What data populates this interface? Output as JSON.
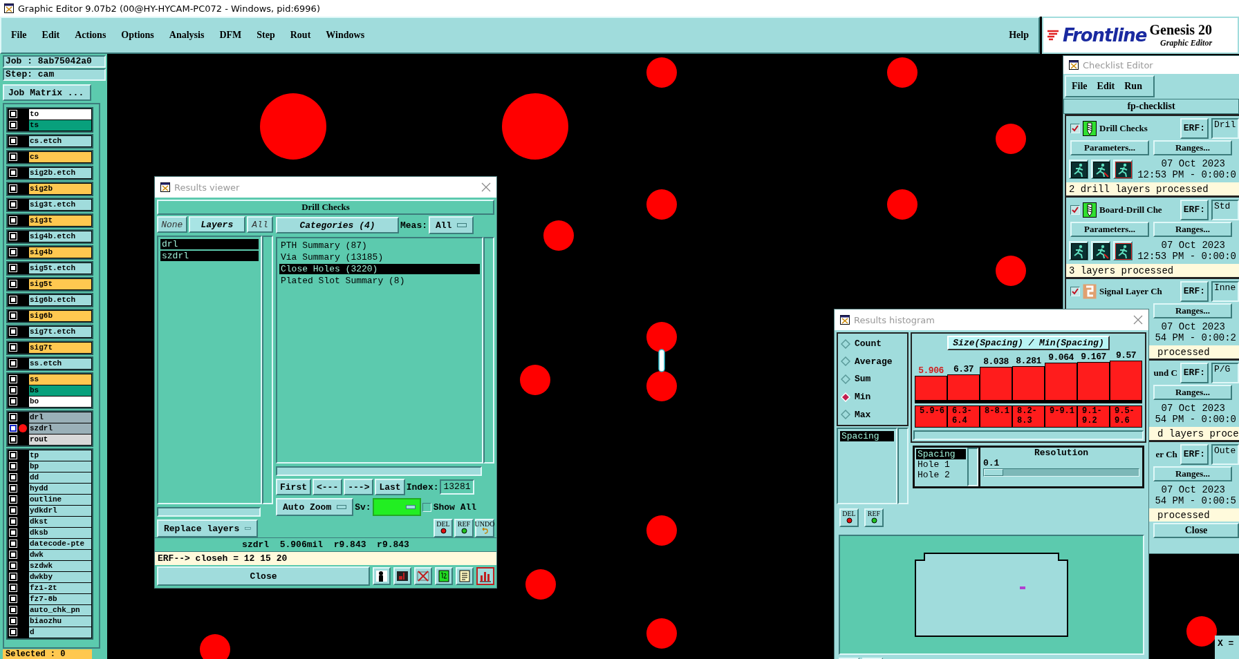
{
  "window": {
    "title": "Graphic Editor 9.07b2 (00@HY-HYCAM-PC072 - Windows, pid:6996)"
  },
  "menu": [
    "File",
    "Edit",
    "Actions",
    "Options",
    "Analysis",
    "DFM",
    "Step",
    "Rout",
    "Windows"
  ],
  "help": "Help",
  "brand": {
    "logo": "Frontline",
    "product": "Genesis 20",
    "subtitle": "Graphic Editor"
  },
  "job": {
    "job": "Job : 8ab75042a0",
    "step": "Step: cam",
    "matrix_button": "Job Matrix ..."
  },
  "layer_groups": [
    {
      "layers": [
        {
          "name": "to",
          "color": "#ffffff",
          "checked": false,
          "work": false
        },
        {
          "name": "ts",
          "color": "#08a07c",
          "checked": false,
          "work": false
        }
      ]
    },
    {
      "layers": [
        {
          "name": "cs.etch",
          "color": "#a0dcdc",
          "checked": false,
          "work": false
        }
      ]
    },
    {
      "layers": [
        {
          "name": "cs",
          "color": "#ffc850",
          "checked": false,
          "work": false
        }
      ]
    },
    {
      "layers": [
        {
          "name": "sig2b.etch",
          "color": "#a0dcdc",
          "checked": false,
          "work": false
        }
      ]
    },
    {
      "layers": [
        {
          "name": "sig2b",
          "color": "#ffc850",
          "checked": false,
          "work": false
        }
      ]
    },
    {
      "layers": [
        {
          "name": "sig3t.etch",
          "color": "#a0dcdc",
          "checked": false,
          "work": false
        }
      ]
    },
    {
      "layers": [
        {
          "name": "sig3t",
          "color": "#ffc850",
          "checked": false,
          "work": false
        }
      ]
    },
    {
      "layers": [
        {
          "name": "sig4b.etch",
          "color": "#a0dcdc",
          "checked": false,
          "work": false
        }
      ]
    },
    {
      "layers": [
        {
          "name": "sig4b",
          "color": "#ffc850",
          "checked": false,
          "work": false
        }
      ]
    },
    {
      "layers": [
        {
          "name": "sig5t.etch",
          "color": "#a0dcdc",
          "checked": false,
          "work": false
        }
      ]
    },
    {
      "layers": [
        {
          "name": "sig5t",
          "color": "#ffc850",
          "checked": false,
          "work": false
        }
      ]
    },
    {
      "layers": [
        {
          "name": "sig6b.etch",
          "color": "#a0dcdc",
          "checked": false,
          "work": false
        }
      ]
    },
    {
      "layers": [
        {
          "name": "sig6b",
          "color": "#ffc850",
          "checked": false,
          "work": false
        }
      ]
    },
    {
      "layers": [
        {
          "name": "sig7t.etch",
          "color": "#a0dcdc",
          "checked": false,
          "work": false
        }
      ]
    },
    {
      "layers": [
        {
          "name": "sig7t",
          "color": "#ffc850",
          "checked": false,
          "work": false
        }
      ]
    },
    {
      "layers": [
        {
          "name": "ss.etch",
          "color": "#a0dcdc",
          "checked": false,
          "work": false
        }
      ]
    },
    {
      "layers": [
        {
          "name": "ss",
          "color": "#ffc850",
          "checked": false,
          "work": false
        },
        {
          "name": "bs",
          "color": "#08a07c",
          "checked": false,
          "work": false
        },
        {
          "name": "bo",
          "color": "#ffffff",
          "checked": false,
          "work": false
        }
      ]
    },
    {
      "layers": [
        {
          "name": "drl",
          "color": "#9ab0b8",
          "checked": false,
          "work": false
        },
        {
          "name": "szdrl",
          "color": "#9ab0b8",
          "checked": false,
          "work": true
        },
        {
          "name": "rout",
          "color": "#d8d8d8",
          "checked": false,
          "work": false
        }
      ]
    },
    {
      "layers": [
        {
          "name": "tp",
          "color": "#a0dcdc",
          "checked": false,
          "work": false
        },
        {
          "name": "bp",
          "color": "#a0dcdc",
          "checked": false,
          "work": false
        },
        {
          "name": "dd",
          "color": "#a0dcdc",
          "checked": false,
          "work": false
        },
        {
          "name": "hydd",
          "color": "#a0dcdc",
          "checked": false,
          "work": false
        },
        {
          "name": "outline",
          "color": "#a0dcdc",
          "checked": false,
          "work": false
        },
        {
          "name": "ydkdrl",
          "color": "#a0dcdc",
          "checked": false,
          "work": false
        },
        {
          "name": "dkst",
          "color": "#a0dcdc",
          "checked": false,
          "work": false
        },
        {
          "name": "dksb",
          "color": "#a0dcdc",
          "checked": false,
          "work": false
        },
        {
          "name": "datecode-pte",
          "color": "#a0dcdc",
          "checked": false,
          "work": false
        },
        {
          "name": "dwk",
          "color": "#a0dcdc",
          "checked": false,
          "work": false
        },
        {
          "name": "szdwk",
          "color": "#a0dcdc",
          "checked": false,
          "work": false
        },
        {
          "name": "dwkby",
          "color": "#a0dcdc",
          "checked": false,
          "work": false
        },
        {
          "name": "fz1-2t",
          "color": "#a0dcdc",
          "checked": false,
          "work": false
        },
        {
          "name": "fz7-8b",
          "color": "#a0dcdc",
          "checked": false,
          "work": false
        },
        {
          "name": "auto_chk_pn",
          "color": "#a0dcdc",
          "checked": false,
          "work": false
        },
        {
          "name": "biaozhu",
          "color": "#a0dcdc",
          "checked": false,
          "work": false
        },
        {
          "name": "d",
          "color": "#a0dcdc",
          "checked": false,
          "work": false
        }
      ]
    }
  ],
  "selected_count": "Selected : 0",
  "results_viewer": {
    "title": "Results viewer",
    "header": "Drill Checks",
    "layer_tabs": [
      {
        "label": "None",
        "selected": false
      },
      {
        "label": "Layers",
        "selected": true
      },
      {
        "label": "All",
        "selected": false
      }
    ],
    "categories_header": "Categories (4)",
    "meas_label": "Meas:",
    "meas_value": "All",
    "layers": [
      {
        "name": "drl",
        "selected": true
      },
      {
        "name": "szdrl",
        "selected": true
      }
    ],
    "categories": [
      {
        "name": "PTH Summary (87)",
        "selected": false
      },
      {
        "name": "Via Summary (13185)",
        "selected": false
      },
      {
        "name": "Close Holes (3220)",
        "selected": true
      },
      {
        "name": "Plated Slot Summary (8)",
        "selected": false
      }
    ],
    "nav_buttons": [
      "First",
      "<---",
      "--->",
      "Last"
    ],
    "index_label": "Index:",
    "index_value": "13281",
    "zoom_mode": "Auto Zoom",
    "sv_label": "Sv:",
    "show_all": {
      "label": "Show All",
      "checked": false
    },
    "replace_mode": "Replace layers",
    "edit_buttons": [
      {
        "label": "DEL",
        "kind": "del"
      },
      {
        "label": "REF",
        "kind": "ref"
      },
      {
        "label": "UNDO",
        "kind": "undo"
      }
    ],
    "status": "szdrl  5.906mil  r9.843  r9.843",
    "erf": "ERF--> closeh = 12 15 20",
    "close": "Close",
    "tool_buttons": [
      {
        "kind": "figure",
        "selected": false
      },
      {
        "kind": "layer",
        "selected": false
      },
      {
        "kind": "cross",
        "selected": false
      },
      {
        "kind": "page",
        "selected": false
      },
      {
        "kind": "notes",
        "selected": false
      },
      {
        "kind": "chart",
        "selected": true
      }
    ]
  },
  "histogram": {
    "title": "Results histogram",
    "modes": [
      {
        "label": "Count",
        "selected": false
      },
      {
        "label": "Average",
        "selected": false
      },
      {
        "label": "Sum",
        "selected": false
      },
      {
        "label": "Min",
        "selected": true
      },
      {
        "label": "Max",
        "selected": false
      }
    ],
    "measures": [
      {
        "name": "Spacing",
        "selected": true
      }
    ],
    "edit_buttons": [
      {
        "label": "DEL",
        "kind": "del"
      },
      {
        "label": "REF",
        "kind": "ref"
      }
    ],
    "chart_data": {
      "type": "bar",
      "title": "Size(Spacing) / Min(Spacing)",
      "categories": [
        "5.9-6",
        "6.3-6.4",
        "8-8.1",
        "8.2-8.3",
        "9-9.1",
        "9.1-9.2",
        "9.5-9.6"
      ],
      "series": [
        {
          "color": "#ff1c1c",
          "values": [
            5.906,
            6.37,
            8.038,
            8.281,
            9.064,
            9.167,
            9.57
          ]
        }
      ],
      "data_labels": true
    },
    "value_labels": [
      "5.906",
      "6.37",
      "8.038",
      "8.281",
      "9.064",
      "9.167",
      "9.57"
    ],
    "fields": [
      {
        "name": "Spacing",
        "selected": true
      },
      {
        "name": "Hole 1",
        "selected": false
      },
      {
        "name": "Hole 2",
        "selected": false
      }
    ],
    "resolution_label": "Resolution",
    "resolution_value": "0.1",
    "resolution": {
      "level": 0.12
    }
  },
  "checklist": {
    "title": "Checklist Editor",
    "menu": [
      "File",
      "Edit",
      "Run"
    ],
    "name": "fp-checklist",
    "entries": [
      {
        "checked": true,
        "kind": "drill",
        "name": "Drill Checks",
        "erf_label": "ERF:",
        "erf": "Dril",
        "parameters": "Parameters...",
        "ranges": "Ranges...",
        "date": "07 Oct 2023",
        "time": "12:53 PM - 0:00:0",
        "status": "2 drill layers processed"
      },
      {
        "checked": true,
        "kind": "drill",
        "name": "Board-Drill Che",
        "erf_label": "ERF:",
        "erf": "Std",
        "parameters": "Parameters...",
        "ranges": "Ranges...",
        "date": "07 Oct 2023",
        "time": "12:53 PM - 0:00:0",
        "status": "3 layers processed"
      },
      {
        "checked": true,
        "kind": "signal",
        "name": "Signal Layer Ch",
        "erf_label": "ERF:",
        "erf": "Inne",
        "ranges": "Ranges...",
        "date": "07 Oct 2023",
        "time": "54 PM - 0:00:2",
        "status": "processed"
      },
      {
        "kind": "covered",
        "name": "und C",
        "erf_label": "ERF:",
        "erf": "P/G",
        "ranges": "Ranges...",
        "date": "07 Oct 2023",
        "time": "54 PM - 0:00:0",
        "status": "d layers proce"
      },
      {
        "kind": "covered",
        "name": "er Ch",
        "erf_label": "ERF:",
        "erf": "Oute",
        "ranges": "Ranges...",
        "date": "07 Oct 2023",
        "time": "54 PM - 0:00:5",
        "status": "processed"
      }
    ],
    "close": "Close"
  },
  "coords": {
    "x": "X ="
  }
}
